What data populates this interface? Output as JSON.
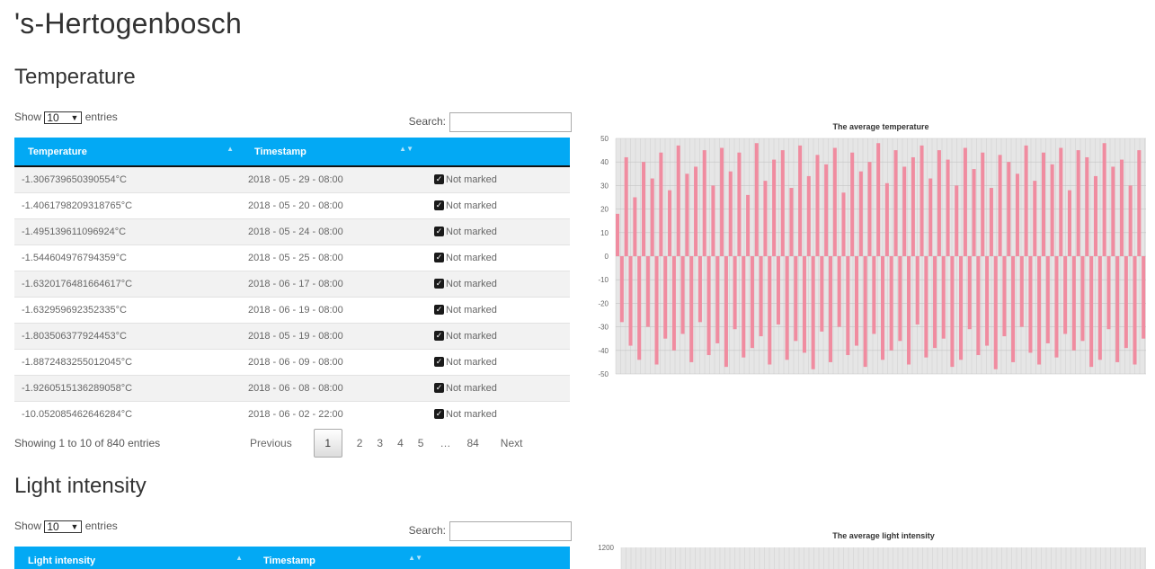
{
  "page": {
    "title": "'s-Hertogenbosch"
  },
  "temperature": {
    "section_title": "Temperature",
    "show_label": "Show",
    "entries_value": "10",
    "entries_label": "entries",
    "search_label": "Search:",
    "columns": [
      "Temperature",
      "Timestamp",
      ""
    ],
    "rows": [
      {
        "value": "-1.306739650390554°C",
        "timestamp": "2018 - 05 - 29 - 08:00",
        "status": "Not marked"
      },
      {
        "value": "-1.4061798209318765°C",
        "timestamp": "2018 - 05 - 20 - 08:00",
        "status": "Not marked"
      },
      {
        "value": "-1.495139611096924°C",
        "timestamp": "2018 - 05 - 24 - 08:00",
        "status": "Not marked"
      },
      {
        "value": "-1.544604976794359°C",
        "timestamp": "2018 - 05 - 25 - 08:00",
        "status": "Not marked"
      },
      {
        "value": "-1.6320176481664617°C",
        "timestamp": "2018 - 06 - 17 - 08:00",
        "status": "Not marked"
      },
      {
        "value": "-1.632959692352335°C",
        "timestamp": "2018 - 06 - 19 - 08:00",
        "status": "Not marked"
      },
      {
        "value": "-1.803506377924453°C",
        "timestamp": "2018 - 05 - 19 - 08:00",
        "status": "Not marked"
      },
      {
        "value": "-1.8872483255012045°C",
        "timestamp": "2018 - 06 - 09 - 08:00",
        "status": "Not marked"
      },
      {
        "value": "-1.9260515136289058°C",
        "timestamp": "2018 - 06 - 08 - 08:00",
        "status": "Not marked"
      },
      {
        "value": "-10.052085462646284°C",
        "timestamp": "2018 - 06 - 02 - 22:00",
        "status": "Not marked"
      }
    ],
    "info": "Showing 1 to 10 of 840 entries",
    "pagination": {
      "previous": "Previous",
      "pages": [
        "1",
        "2",
        "3",
        "4",
        "5"
      ],
      "ellipsis": "…",
      "last": "84",
      "next": "Next",
      "current": "1"
    }
  },
  "light": {
    "section_title": "Light intensity",
    "show_label": "Show",
    "entries_value": "10",
    "entries_label": "entries",
    "search_label": "Search:",
    "columns": [
      "Light intensity",
      "Timestamp",
      ""
    ]
  },
  "charts": {
    "accent_color": "#03a9f4",
    "series_color": "#f08ca0"
  },
  "chart_data": [
    {
      "type": "bar",
      "title": "The average temperature",
      "yticks": [
        50,
        40,
        30,
        20,
        10,
        0,
        -10,
        -20,
        -30,
        -40,
        -50
      ],
      "ylim": [
        -50,
        50
      ],
      "grid": true,
      "description_series": "dense daily oscillation between about -48 and 48",
      "series": [
        {
          "values": [
            18,
            -28,
            42,
            -38,
            25,
            -44,
            40,
            -30,
            33,
            -46,
            44,
            -35,
            28,
            -40,
            47,
            -33,
            35,
            -45,
            38,
            -28,
            45,
            -42,
            30,
            -37,
            46,
            -47,
            36,
            -31,
            44,
            -43,
            26,
            -39,
            48,
            -34,
            32,
            -46,
            41,
            -29,
            45,
            -44,
            29,
            -36,
            47,
            -41,
            34,
            -48,
            43,
            -32,
            39,
            -45,
            46,
            -30,
            27,
            -42,
            44,
            -38,
            36,
            -47,
            40,
            -33,
            48,
            -44,
            31,
            -40,
            45,
            -36,
            38,
            -46,
            42,
            -29,
            47,
            -43,
            33,
            -39,
            45,
            -35,
            41,
            -47,
            30,
            -44,
            46,
            -31,
            37,
            -42,
            44,
            -38,
            29,
            -48,
            43,
            -34,
            40,
            -45,
            35,
            -30,
            47,
            -41,
            32,
            -46,
            44,
            -37,
            39,
            -43,
            46,
            -33,
            28,
            -40,
            45,
            -36,
            42,
            -47,
            34,
            -44,
            48,
            -31,
            38,
            -45,
            41,
            -39,
            30,
            -46,
            45,
            -35
          ]
        }
      ]
    },
    {
      "type": "bar",
      "title": "The average light intensity",
      "yticks": [
        1200
      ],
      "ylim": [
        0,
        1200
      ],
      "grid": true,
      "series": [
        {
          "values": []
        }
      ]
    }
  ]
}
